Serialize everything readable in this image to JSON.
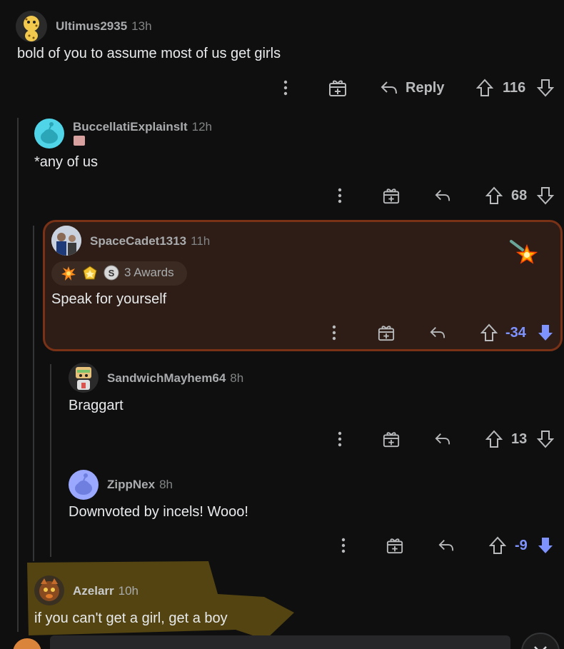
{
  "comments": [
    {
      "username": "Ultimus2935",
      "time": "13h",
      "text": "bold of you to assume most of us get girls",
      "reply_label": "Reply",
      "votes": "116",
      "vote_state": "none",
      "avatar_icon": "cheetah-snoo-avatar"
    },
    {
      "username": "BuccellatiExplainsIt",
      "time": "12h",
      "text": "*any of us",
      "votes": "68",
      "vote_state": "none",
      "avatar_icon": "default-snoo-avatar"
    },
    {
      "username": "SpaceCadet1313",
      "time": "11h",
      "awards_label": "3 Awards",
      "text": "Speak for yourself",
      "votes": "-34",
      "vote_state": "downvoted",
      "avatar_icon": "photo-avatar"
    },
    {
      "username": "SandwichMayhem64",
      "time": "8h",
      "text": "Braggart",
      "votes": "13",
      "vote_state": "none",
      "avatar_icon": "snoo-costume-avatar"
    },
    {
      "username": "ZippNex",
      "time": "8h",
      "text": "Downvoted by incels! Wooo!",
      "votes": "-9",
      "vote_state": "downvoted",
      "avatar_icon": "default-snoo-avatar"
    },
    {
      "username": "Azelarr",
      "time": "10h",
      "text": "if you can't get a girl, get a boy",
      "avatar_icon": "animal-avatar"
    }
  ],
  "colors": {
    "background": "#0f0f10",
    "highlight_bg": "#2d1d16",
    "highlight_border": "#7a3217",
    "downvote": "#7f93ff",
    "scribble": "#5b4a12"
  }
}
